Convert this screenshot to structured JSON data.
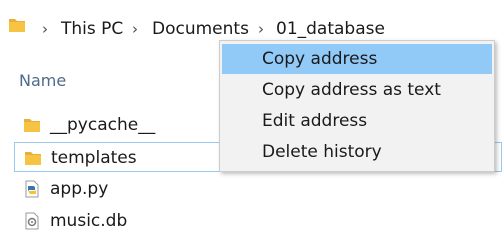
{
  "address_bar": {
    "folder_icon": "folder-icon",
    "crumbs": [
      "This PC",
      "Documents",
      "01_database"
    ],
    "separator_icon": "chevron-right-icon",
    "separator": "›"
  },
  "file_list": {
    "column_header": "Name",
    "items": [
      {
        "name": "__pycache__",
        "icon": "folder-icon",
        "selected": false
      },
      {
        "name": "templates",
        "icon": "folder-icon",
        "selected": true
      },
      {
        "name": "app.py",
        "icon": "python-file-icon",
        "selected": false
      },
      {
        "name": "music.db",
        "icon": "database-file-icon",
        "selected": false
      }
    ]
  },
  "context_menu": {
    "items": [
      {
        "label": "Copy address",
        "highlighted": true
      },
      {
        "label": "Copy address as text",
        "highlighted": false
      },
      {
        "label": "Edit address",
        "highlighted": false
      },
      {
        "label": "Delete history",
        "highlighted": false
      }
    ]
  },
  "colors": {
    "folder": "#f6c343",
    "highlight": "#91c9f7",
    "selection_border": "#99c9ef",
    "menu_bg": "#f2f2f2"
  }
}
